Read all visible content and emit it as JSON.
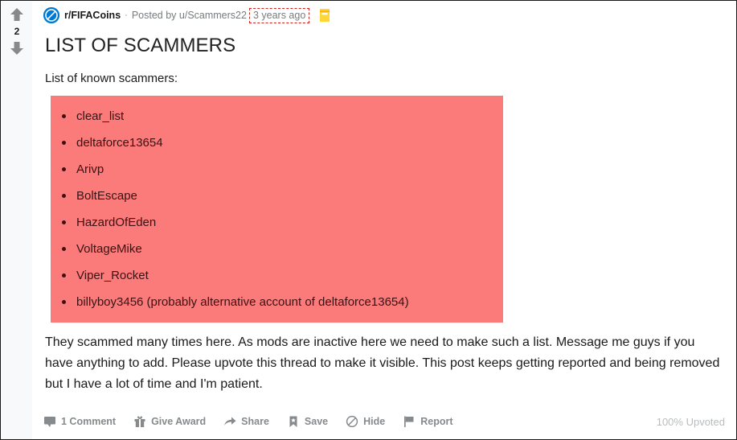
{
  "vote": {
    "upvote_icon": "arrow-up-icon",
    "score": "2",
    "downvote_icon": "arrow-down-icon"
  },
  "post": {
    "subreddit_icon": "subreddit-avatar-icon",
    "subreddit": "r/FIFACoins",
    "separator": "·",
    "posted_by": "Posted by u/Scammers22",
    "timestamp": "3 years ago",
    "award_icon": "award-badge-icon",
    "title": "LIST OF SCAMMERS",
    "intro": "List of known scammers:",
    "highlight_color": "#fb7a7a",
    "scammers": [
      "clear_list",
      "deltaforce13654",
      "Arivp",
      "BoltEscape",
      "HazardOfEden",
      "VoltageMike",
      "Viper_Rocket",
      "billyboy3456 (probably alternative account of deltaforce13654)"
    ],
    "body": "They scammed many times here. As mods are inactive here we need to make such a list. Message me guys if you have anything to add. Please upvote this thread to make it visible. This post keeps getting reported and being removed but I have a lot of time and I'm patient."
  },
  "footer": {
    "actions": [
      {
        "icon": "comment-icon",
        "label": "1 Comment"
      },
      {
        "icon": "gift-icon",
        "label": "Give Award"
      },
      {
        "icon": "share-icon",
        "label": "Share"
      },
      {
        "icon": "bookmark-icon",
        "label": "Save"
      },
      {
        "icon": "hide-icon",
        "label": "Hide"
      },
      {
        "icon": "flag-icon",
        "label": "Report"
      }
    ],
    "upvoted_ratio": "100% Upvoted"
  }
}
